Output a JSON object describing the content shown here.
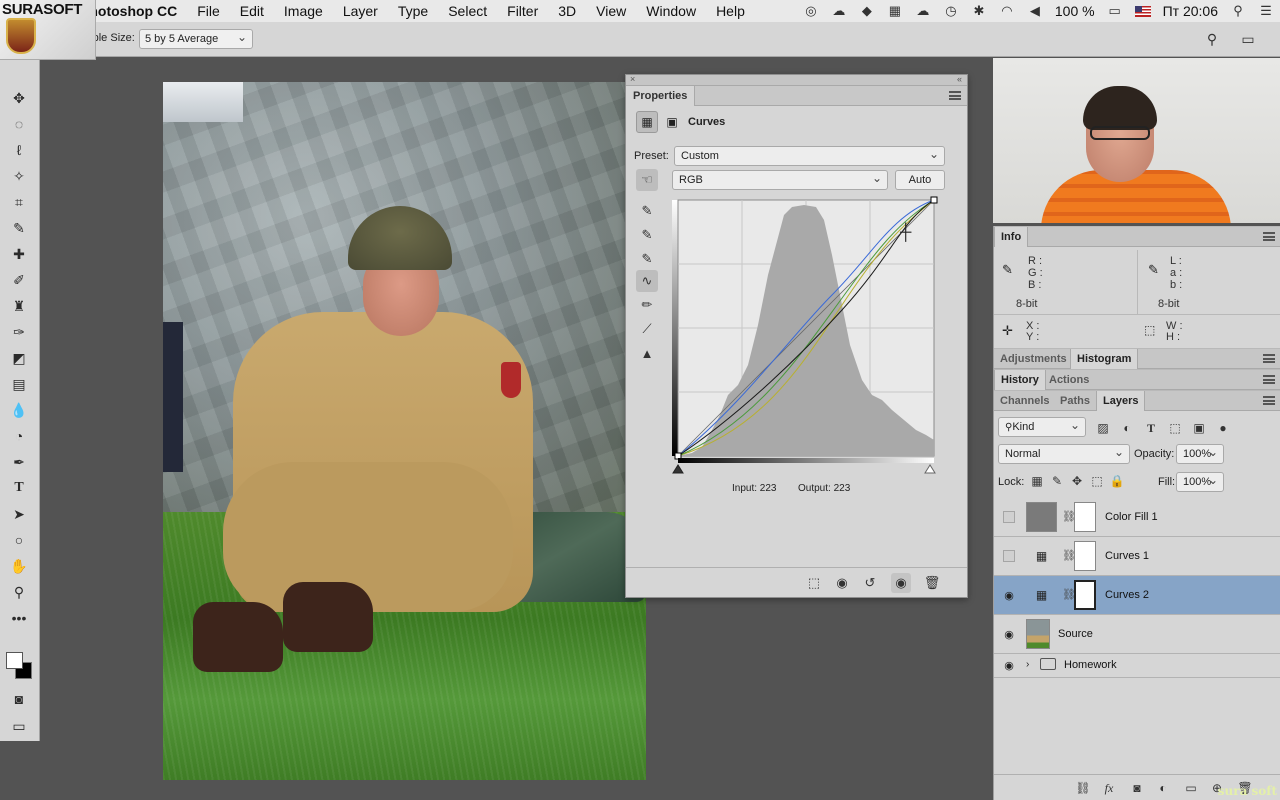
{
  "menubar": {
    "brand": "SURASOFT",
    "items": [
      "Photoshop CC",
      "File",
      "Edit",
      "Image",
      "Layer",
      "Type",
      "Select",
      "Filter",
      "3D",
      "View",
      "Window",
      "Help"
    ],
    "status": {
      "battery": "100 %",
      "clock": "Пт 20:06",
      "icons": [
        "creative-cloud-icon",
        "cc-libraries-icon",
        "dropbox-icon",
        "calendar-icon",
        "cloud-sync-icon",
        "time-machine-icon",
        "bluetooth-icon",
        "wifi-icon",
        "volume-icon",
        "battery-icon",
        "flag-icon",
        "search-icon",
        "list-icon"
      ]
    }
  },
  "options": {
    "sample_size_label": "Sample Size:",
    "sample_size_value": "5 by 5 Average"
  },
  "properties": {
    "tab": "Properties",
    "title": "Curves",
    "preset_label": "Preset:",
    "preset_value": "Custom",
    "channel_value": "RGB",
    "auto_label": "Auto",
    "input_text": "Input: 223",
    "output_text": "Output: 223",
    "curve_colors": {
      "rgb": "#1a1a1a",
      "red": "#c04040",
      "green": "#4a9a3a",
      "blue": "#3a6ad8",
      "yellow": "#b8b030"
    }
  },
  "info_panel": {
    "tab": "Info",
    "left_channels": [
      "R :",
      "G :",
      "B :"
    ],
    "right_channels": [
      "L :",
      "a :",
      "b :"
    ],
    "bits_left": "8-bit",
    "bits_right": "8-bit",
    "xy": [
      "X :",
      "Y :"
    ],
    "wh": [
      "W :",
      "H :"
    ]
  },
  "dock_tabs": {
    "row1": [
      "Adjustments",
      "Histogram"
    ],
    "row2": [
      "History",
      "Actions"
    ],
    "row3": [
      "Channels",
      "Paths",
      "Layers"
    ]
  },
  "layers_panel": {
    "filter_kind": "Kind",
    "blend_mode": "Normal",
    "opacity_label": "Opacity:",
    "opacity_value": "100%",
    "lock_label": "Lock:",
    "fill_label": "Fill:",
    "fill_value": "100%",
    "layers": [
      {
        "name": "Color Fill 1",
        "visible": false,
        "selected": false
      },
      {
        "name": "Curves 1",
        "visible": false,
        "selected": false
      },
      {
        "name": "Curves 2",
        "visible": true,
        "selected": true
      },
      {
        "name": "Source",
        "visible": true,
        "selected": false
      },
      {
        "name": "Homework",
        "visible": true,
        "selected": false
      }
    ]
  },
  "watermark": "sura soft"
}
